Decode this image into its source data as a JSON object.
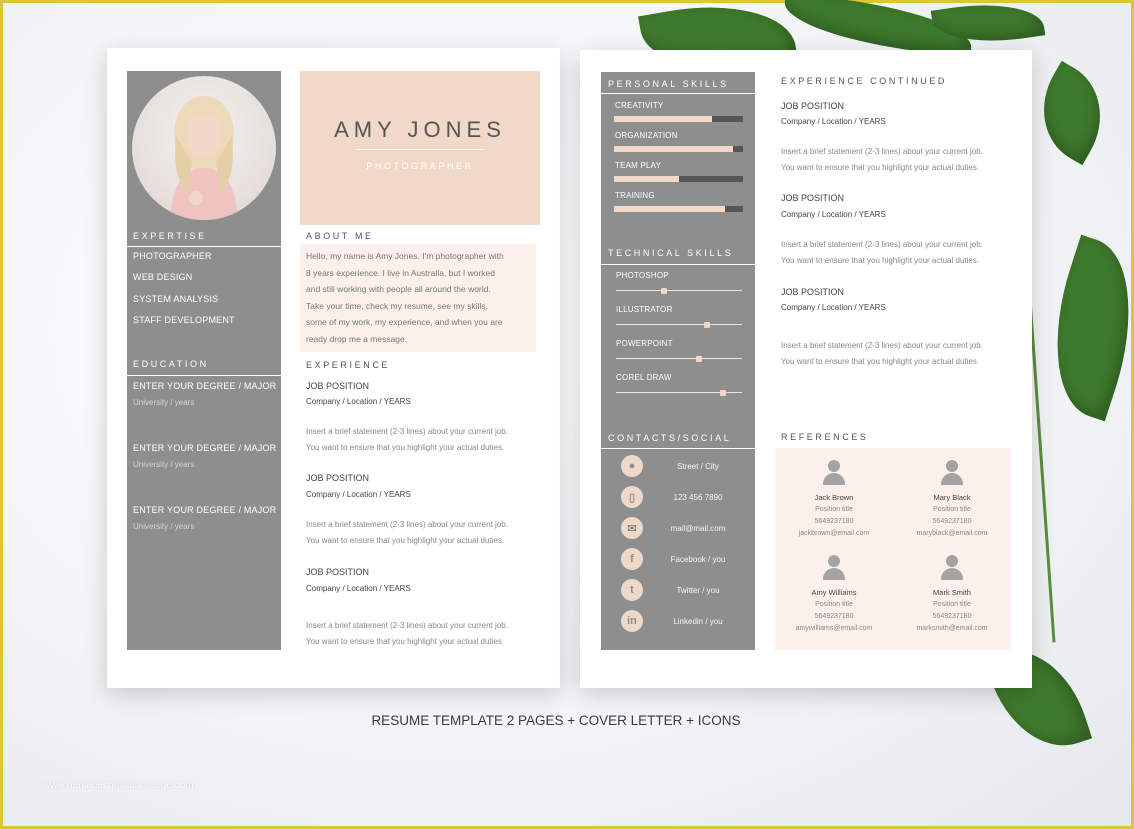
{
  "page1": {
    "name": "AMY JONES",
    "role": "PHOTOGRAPHER",
    "expertise": {
      "heading": "EXPERTISE",
      "items": [
        "PHOTOGRAPHER",
        "WEB DESIGN",
        "SYSTEM ANALYSIS",
        "STAFF DEVELOPMENT"
      ]
    },
    "education": {
      "heading": "EDUCATION",
      "items": [
        {
          "degree": "ENTER YOUR DEGREE / MAJOR",
          "school": "University / years"
        },
        {
          "degree": "ENTER YOUR DEGREE / MAJOR",
          "school": "University / years"
        },
        {
          "degree": "ENTER YOUR DEGREE / MAJOR",
          "school": "University / years"
        }
      ]
    },
    "about": {
      "heading": "ABOUT ME",
      "lines": [
        "Hello, my name is Amy Jones. I'm photographer with",
        "8 years experience. I live in Australia, but I worked",
        "and still working with people all around the world.",
        "Take your time, check my resume, see my skills,",
        "some of my work, my experience, and when you are",
        "ready drop me a message."
      ]
    },
    "experience": {
      "heading": "EXPERIENCE",
      "jobs": [
        {
          "title": "JOB POSITION",
          "sub": "Company / Location / YEARS",
          "desc1": "Insert a brief statement (2-3 lines) about your current job.",
          "desc2": "You want to ensure that you highlight your actual duties."
        },
        {
          "title": "JOB POSITION",
          "sub": "Company / Location / YEARS",
          "desc1": "Insert a brief statement (2-3 lines) about your current job.",
          "desc2": "You want to ensure that you highlight your actual duties."
        },
        {
          "title": "JOB POSITION",
          "sub": "Company / Location / YEARS",
          "desc1": "Insert a brief statement (2-3 lines) about your current job.",
          "desc2": "You want to ensure that you highlight your actual duties"
        }
      ]
    }
  },
  "page2": {
    "personal_skills": {
      "heading": "PERSONAL SKILLS",
      "items": [
        {
          "label": "CREATIVITY",
          "level": 0.76
        },
        {
          "label": "ORGANIZATION",
          "level": 0.92
        },
        {
          "label": "TEAM PLAY",
          "level": 0.5
        },
        {
          "label": "TRAINING",
          "level": 0.86
        }
      ]
    },
    "technical_skills": {
      "heading": "TECHNICAL SKILLS",
      "items": [
        {
          "label": "PHOTOSHOP",
          "level": 0.38
        },
        {
          "label": "ILLUSTRATOR",
          "level": 0.72
        },
        {
          "label": "POWERPOINT",
          "level": 0.66
        },
        {
          "label": "COREL DRAW",
          "level": 0.85
        }
      ]
    },
    "contacts": {
      "heading": "CONTACTS/SOCIAL",
      "items": [
        {
          "icon": "location-pin-icon",
          "glyph": "●",
          "text": "Street / City"
        },
        {
          "icon": "phone-icon",
          "glyph": "▯",
          "text": "123 456 7890"
        },
        {
          "icon": "mail-icon",
          "glyph": "✉",
          "text": "mail@mail.com"
        },
        {
          "icon": "facebook-icon",
          "glyph": "f",
          "text": "Facebook / you"
        },
        {
          "icon": "twitter-icon",
          "glyph": "t",
          "text": "Twitter / you"
        },
        {
          "icon": "linkedin-icon",
          "glyph": "in",
          "text": "Linkedin / you"
        }
      ]
    },
    "experience_continued": {
      "heading": "EXPERIENCE CONTINUED",
      "jobs": [
        {
          "title": "JOB POSITION",
          "sub": "Company / Location / YEARS",
          "desc1": "Insert a brief statement (2-3 lines) about your current job.",
          "desc2": "You want to ensure that you highlight your actual duties."
        },
        {
          "title": "JOB POSITION",
          "sub": "Company / Location / YEARS",
          "desc1": "Insert a brief statement (2-3 lines) about your current job.",
          "desc2": "You want to ensure that you highlight your actual duties."
        },
        {
          "title": "JOB POSITION",
          "sub": "Company / Location / YEARS",
          "desc1": "Insert a brief statement (2-3 lines) about your current job.",
          "desc2": "You want to ensure that you highlight your actual duties"
        }
      ]
    },
    "references": {
      "heading": "REFERENCES",
      "people": [
        {
          "name": "Jack Brown",
          "position": "Position title",
          "phone": "5649237180",
          "email": "jackbrown@email.com"
        },
        {
          "name": "Mary Black",
          "position": "Position title",
          "phone": "5649237180",
          "email": "maryblack@email.com"
        },
        {
          "name": "Amy Williams",
          "position": "Position title",
          "phone": "5649237180",
          "email": "amywilliams@email.com"
        },
        {
          "name": "Mark Smith",
          "position": "Position title",
          "phone": "5649237180",
          "email": "marksmith@email.com"
        }
      ]
    }
  },
  "caption": "RESUME TEMPLATE 2 PAGES + COVER LETTER + ICONS",
  "watermark": "www.heritagechristiancollege.com",
  "colors": {
    "sidebar_gray": "#8e8e8e",
    "peach": "#f1d9c9",
    "dark_bar": "#555555"
  }
}
